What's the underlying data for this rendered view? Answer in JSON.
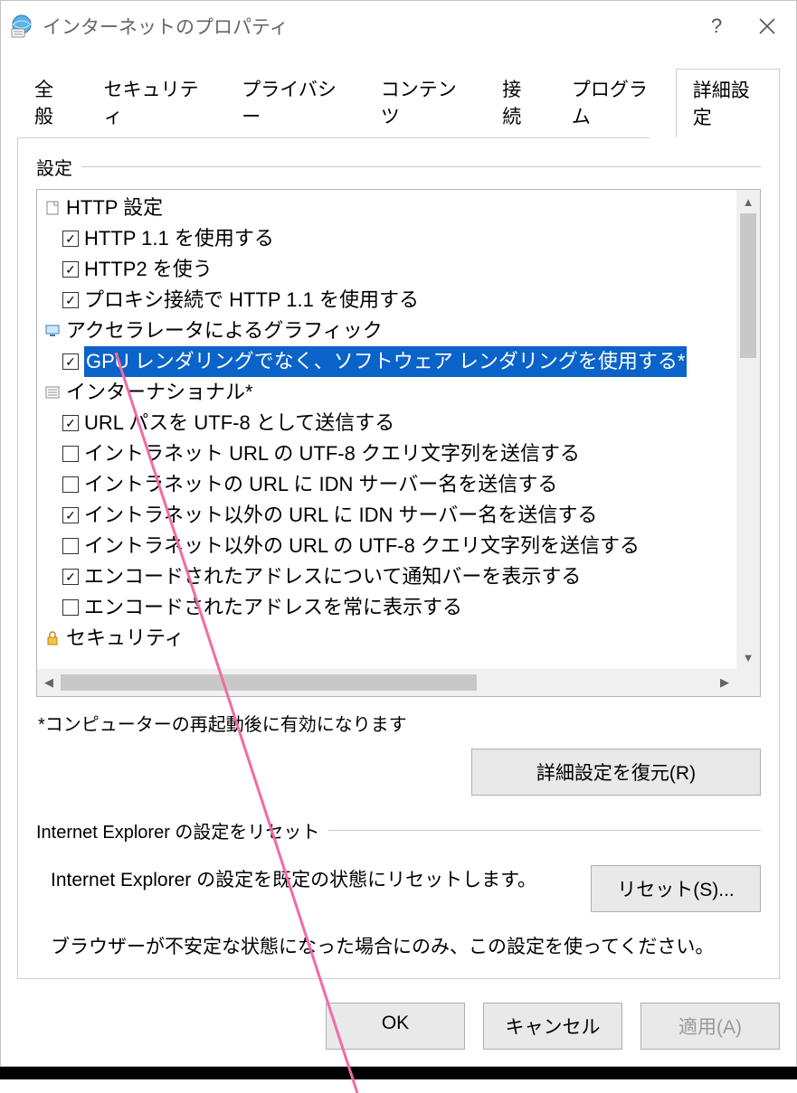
{
  "window": {
    "title": "インターネットのプロパティ"
  },
  "tabs": {
    "general": "全般",
    "security": "セキュリティ",
    "privacy": "プライバシー",
    "content": "コンテンツ",
    "connections": "接続",
    "programs": "プログラム",
    "advanced": "詳細設定"
  },
  "settings_group": {
    "label": "設定",
    "restart_note": "*コンピューターの再起動後に有効になります",
    "restore_button": "詳細設定を復元(R)"
  },
  "tree": {
    "http": {
      "label": "HTTP 設定",
      "items": [
        {
          "checked": true,
          "label": "HTTP 1.1 を使用する"
        },
        {
          "checked": true,
          "label": "HTTP2 を使う"
        },
        {
          "checked": true,
          "label": "プロキシ接続で HTTP 1.1 を使用する"
        }
      ]
    },
    "gpu": {
      "label": "アクセラレータによるグラフィック",
      "items": [
        {
          "checked": true,
          "label": "GPU レンダリングでなく、ソフトウェア レンダリングを使用する*",
          "selected": true
        }
      ]
    },
    "intl": {
      "label": "インターナショナル*",
      "items": [
        {
          "checked": true,
          "label": "URL パスを UTF-8 として送信する"
        },
        {
          "checked": false,
          "label": "イントラネット URL の UTF-8 クエリ文字列を送信する"
        },
        {
          "checked": false,
          "label": "イントラネットの URL に IDN サーバー名を送信する"
        },
        {
          "checked": true,
          "label": "イントラネット以外の URL に IDN サーバー名を送信する"
        },
        {
          "checked": false,
          "label": "イントラネット以外の URL の UTF-8 クエリ文字列を送信する"
        },
        {
          "checked": true,
          "label": "エンコードされたアドレスについて通知バーを表示する"
        },
        {
          "checked": false,
          "label": "エンコードされたアドレスを常に表示する"
        }
      ]
    },
    "securitycat": {
      "label": "セキュリティ"
    }
  },
  "reset_group": {
    "label": "Internet Explorer の設定をリセット",
    "desc": "Internet Explorer の設定を既定の状態にリセットします。",
    "button": "リセット(S)...",
    "hint": "ブラウザーが不安定な状態になった場合にのみ、この設定を使ってください。"
  },
  "buttons": {
    "ok": "OK",
    "cancel": "キャンセル",
    "apply": "適用(A)"
  }
}
